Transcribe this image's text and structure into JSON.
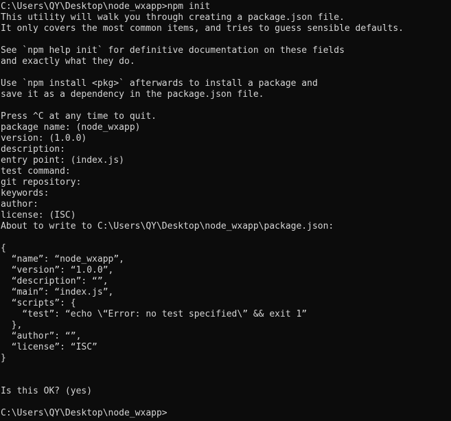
{
  "terminal": {
    "window_title": "C:\\WINDOWS\\system32\\cmd.exe",
    "background_color": "#0c0c0c",
    "foreground_color": "#d6d6d6",
    "cwd": "C:\\Users\\QY\\Desktop\\node_wxapp",
    "prompt_symbol": ">",
    "command": "npm init"
  },
  "lines": [
    {
      "id": "prompt-command",
      "text": "C:\\Users\\QY\\Desktop\\node_wxapp>npm init"
    },
    {
      "id": "intro-1",
      "text": "This utility will walk you through creating a package.json file."
    },
    {
      "id": "intro-2",
      "text": "It only covers the most common items, and tries to guess sensible defaults."
    },
    {
      "id": "blank-1",
      "text": ""
    },
    {
      "id": "help-1",
      "text": "See `npm help init` for definitive documentation on these fields"
    },
    {
      "id": "help-2",
      "text": "and exactly what they do."
    },
    {
      "id": "blank-2",
      "text": ""
    },
    {
      "id": "install-hint-1",
      "text": "Use `npm install <pkg>` afterwards to install a package and"
    },
    {
      "id": "install-hint-2",
      "text": "save it as a dependency in the package.json file."
    },
    {
      "id": "blank-3",
      "text": ""
    },
    {
      "id": "quit-hint",
      "text": "Press ^C at any time to quit."
    },
    {
      "id": "field-package-name",
      "text": "package name: (node_wxapp)"
    },
    {
      "id": "field-version",
      "text": "version: (1.0.0)"
    },
    {
      "id": "field-description",
      "text": "description:"
    },
    {
      "id": "field-entry-point",
      "text": "entry point: (index.js)"
    },
    {
      "id": "field-test-command",
      "text": "test command:"
    },
    {
      "id": "field-git-repository",
      "text": "git repository:"
    },
    {
      "id": "field-keywords",
      "text": "keywords:"
    },
    {
      "id": "field-author",
      "text": "author:"
    },
    {
      "id": "field-license",
      "text": "license: (ISC)"
    },
    {
      "id": "about-to-write",
      "text": "About to write to C:\\Users\\QY\\Desktop\\node_wxapp\\package.json:"
    },
    {
      "id": "blank-4",
      "text": ""
    },
    {
      "id": "json-open-brace",
      "text": "{"
    },
    {
      "id": "json-name",
      "text": "  “name”: “node_wxapp”,"
    },
    {
      "id": "json-version",
      "text": "  “version”: “1.0.0”,"
    },
    {
      "id": "json-description",
      "text": "  “description”: “”,"
    },
    {
      "id": "json-main",
      "text": "  “main”: “index.js”,"
    },
    {
      "id": "json-scripts-open",
      "text": "  “scripts”: {"
    },
    {
      "id": "json-scripts-test",
      "text": "    “test”: “echo \\“Error: no test specified\\” && exit 1”"
    },
    {
      "id": "json-scripts-close",
      "text": "  },"
    },
    {
      "id": "json-author",
      "text": "  “author”: “”,"
    },
    {
      "id": "json-license",
      "text": "  “license”: “ISC”"
    },
    {
      "id": "json-close-brace",
      "text": "}"
    },
    {
      "id": "blank-5",
      "text": ""
    },
    {
      "id": "blank-6",
      "text": ""
    },
    {
      "id": "confirm-prompt",
      "text": "Is this OK? (yes)"
    },
    {
      "id": "blank-7",
      "text": ""
    },
    {
      "id": "final-prompt",
      "text": "C:\\Users\\QY\\Desktop\\node_wxapp>"
    }
  ],
  "package_json": {
    "name": "node_wxapp",
    "version": "1.0.0",
    "description": "",
    "main": "index.js",
    "scripts": {
      "test": "echo \"Error: no test specified\" && exit 1"
    },
    "author": "",
    "license": "ISC"
  },
  "prompts": {
    "package_name_default": "node_wxapp",
    "version_default": "1.0.0",
    "entry_point_default": "index.js",
    "license_default": "ISC",
    "confirm_default": "yes",
    "target_path": "C:\\Users\\QY\\Desktop\\node_wxapp\\package.json"
  }
}
